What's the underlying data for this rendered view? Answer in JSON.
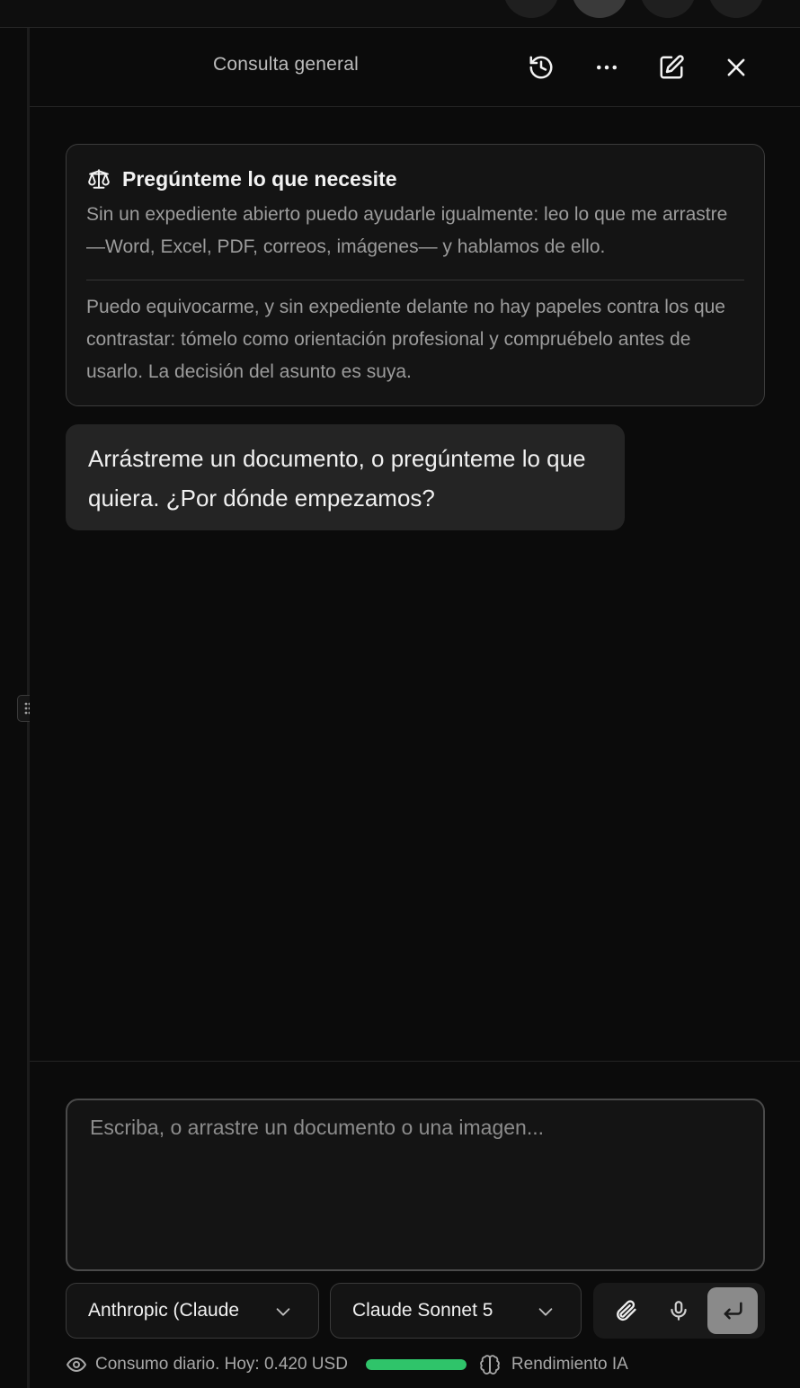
{
  "header": {
    "title": "Consulta general",
    "icons": [
      "history-icon",
      "more-icon",
      "edit-icon",
      "close-icon"
    ]
  },
  "notice": {
    "icon": "scale-icon",
    "title": "Pregúnteme lo que necesite",
    "paragraph1": "Sin un expediente abierto puedo ayudarle igualmente: leo lo que me arrastre —Word, Excel, PDF, correos, imágenes— y hablamos de ello.",
    "paragraph2": "Puedo equivocarme, y sin expediente delante no hay papeles contra los que contrastar: tómelo como orientación profesional y compruébelo antes de usarlo. La decisión del asunto es suya."
  },
  "message": {
    "text": "Arrástreme un documento, o pregúnteme lo que quiera. ¿Por dónde empezamos?"
  },
  "composer": {
    "placeholder": "Escriba, o arrastre un documento o una imagen..."
  },
  "provider_select": {
    "value": "Anthropic (Claude"
  },
  "model_select": {
    "value": "Claude Sonnet 5"
  },
  "tools": [
    "paperclip-icon",
    "microphone-icon",
    "send-icon"
  ],
  "usage": {
    "label": "Consumo diario. Hoy: 0.420 USD",
    "fraction": 1.0,
    "bar_color": "#2fc46a",
    "performance_label": "Rendimiento IA"
  },
  "colors": {
    "background": "#0b0b0b",
    "card": "#141414",
    "bubble": "#242424",
    "accent_green": "#2fc46a"
  }
}
